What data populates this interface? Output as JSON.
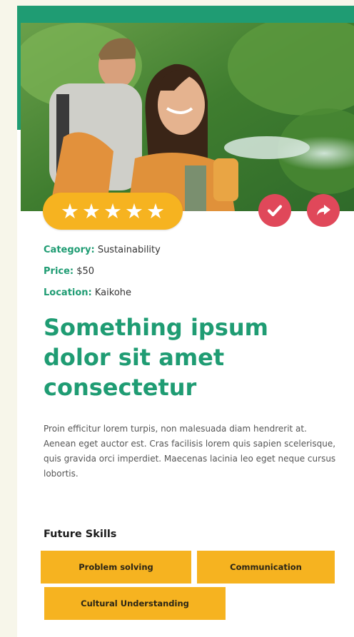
{
  "card": {
    "rating": {
      "stars": 5,
      "max": 5,
      "star_glyph": "★",
      "color": "#f6b320"
    },
    "actions": {
      "check_icon": "check-icon",
      "share_icon": "share-arrow-icon",
      "color": "#e0485a"
    },
    "meta": {
      "category_label": "Category:",
      "category_value": "Sustainability",
      "price_label": "Price:",
      "price_value": "$50",
      "location_label": "Location:",
      "location_value": "Kaikohe"
    },
    "title": "Something ipsum dolor sit amet consectetur",
    "description": "Proin efficitur lorem turpis, non malesuada diam hendrerit at. Aenean eget auctor est. Cras facilisis lorem quis sapien scelerisque, quis gravida orci imperdiet. Maecenas lacinia leo eget neque cursus lobortis.",
    "skills": {
      "heading": "Future Skills",
      "tags": [
        "Problem solving",
        "Communication",
        "Cultural Understanding"
      ]
    }
  },
  "colors": {
    "accent_green": "#1f9c73",
    "tag_yellow": "#f6b320",
    "page_bg": "#f7f6ea"
  }
}
